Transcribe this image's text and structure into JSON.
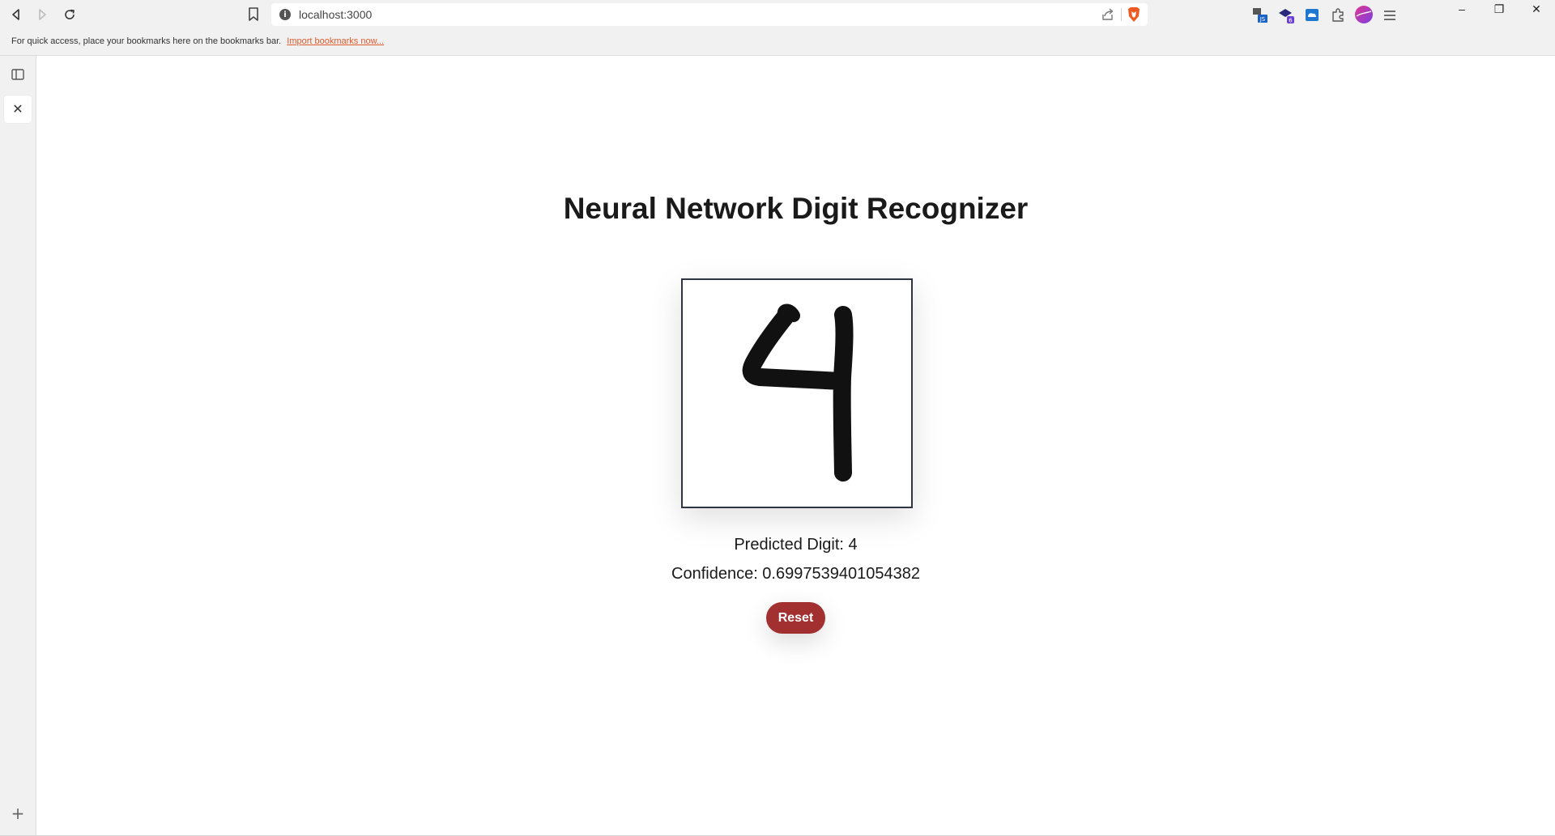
{
  "browser": {
    "url": "localhost:3000",
    "url_info_glyph": "i",
    "bookmarks_message": "For quick access, place your bookmarks here on the bookmarks bar.",
    "bookmarks_link": "Import bookmarks now...",
    "icons": [
      "back-icon",
      "forward-icon",
      "reload-icon",
      "bookmark-icon",
      "site-info-icon",
      "share-icon",
      "brave-shield-icon",
      "extension-icon",
      "puzzle-icon",
      "profile-icon",
      "menu-icon",
      "minimize-icon",
      "restore-icon",
      "close-window-icon"
    ]
  },
  "sidebar": {
    "close_glyph": "✕",
    "add_glyph": "+"
  },
  "page": {
    "title": "Neural Network Digit Recognizer",
    "predicted_label": "Predicted Digit: 4",
    "confidence_label": "Confidence: 0.6997539401054382",
    "reset_label": "Reset",
    "drawing_stroke_color": "#111111",
    "reset_color": "#a33030"
  },
  "window": {
    "minimize_glyph": "–",
    "restore_glyph": "❐",
    "close_glyph": "✕"
  }
}
